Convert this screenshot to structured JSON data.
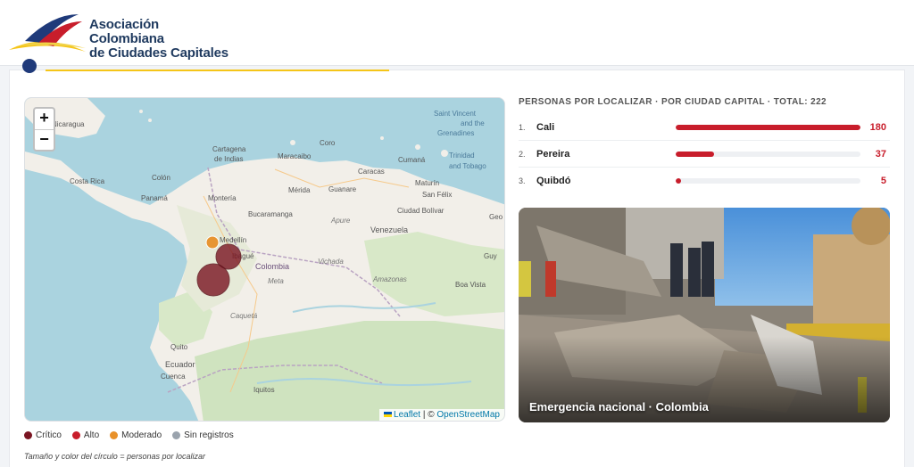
{
  "brand": {
    "line1": "Asociación Colombiana",
    "line2": "de Ciudades Capitales"
  },
  "map": {
    "zoom_in": "+",
    "zoom_out": "−",
    "attribution_leaflet": "Leaflet",
    "attribution_sep": " | © ",
    "attribution_osm": "OpenStreetMap",
    "labels": {
      "nicaragua": "Nicaragua",
      "costa_rica": "Costa Rica",
      "colon": "Colón",
      "panama": "Panamá",
      "cartagena": "Cartagena",
      "de_indias": "de Indias",
      "maracaibo": "Maracaibo",
      "coro": "Coro",
      "caracas": "Caracas",
      "cumana": "Cumaná",
      "merida": "Mérida",
      "guanare": "Guanare",
      "maturin": "Maturín",
      "san_felix": "San Félix",
      "ciudad_bolivar": "Ciudad Bolívar",
      "monteria": "Montería",
      "bucaramanga": "Bucaramanga",
      "venezuela": "Venezuela",
      "medellin": "Medellín",
      "ibague": "Ibagué",
      "colombia": "Colombia",
      "apure": "Apure",
      "vichada": "Vichada",
      "amazonas": "Amazonas",
      "boa_vista": "Boa Vista",
      "meta": "Meta",
      "caqueta": "Caquetá",
      "quito": "Quito",
      "ecuador": "Ecuador",
      "cuenca": "Cuenca",
      "iquitos": "Iquitos",
      "st_vincent": "Saint Vincent",
      "and_the": "and the",
      "grenadines": "Grenadines",
      "trinidad": "Trinidad",
      "and_tobago": "and Tobago",
      "geo": "Geo",
      "guy": "Guy"
    }
  },
  "legend": [
    {
      "label": "Crítico",
      "color": "#7a1522"
    },
    {
      "label": "Alto",
      "color": "#c81d2b"
    },
    {
      "label": "Moderado",
      "color": "#e8912a"
    },
    {
      "label": "Sin registros",
      "color": "#9aa3ad"
    }
  ],
  "note": "Tamaño y color del círculo = personas por localizar",
  "panel": {
    "title": "Personas por localizar · por ciudad capital · Total: 222",
    "rows": [
      {
        "rank": "1.",
        "city": "Cali",
        "value": "180",
        "fraction": 1.0
      },
      {
        "rank": "2.",
        "city": "Pereira",
        "value": "37",
        "fraction": 0.21
      },
      {
        "rank": "3.",
        "city": "Quibdó",
        "value": "5",
        "fraction": 0.03
      }
    ],
    "photo_caption": "Emergencia nacional · Colombia"
  },
  "colors": {
    "critical": "#7a1522",
    "high": "#c81d2b",
    "moderate": "#e8912a",
    "accent_yellow": "#f5c518",
    "brand_navy": "#1f3a5f"
  }
}
